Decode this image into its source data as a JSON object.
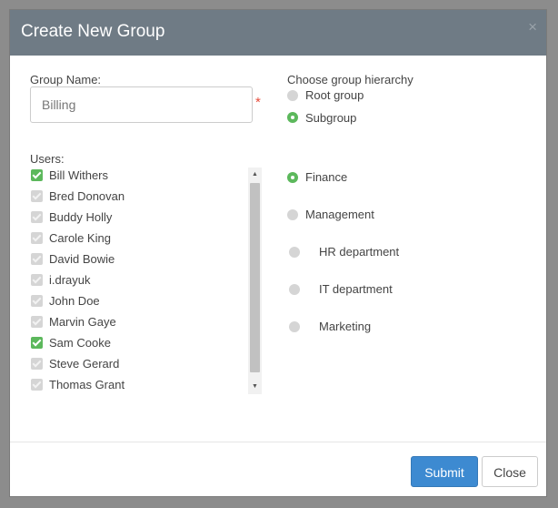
{
  "dialog": {
    "title": "Create New Group",
    "close_glyph": "×"
  },
  "form": {
    "group_name_label": "Group Name:",
    "group_name_value": "Billing",
    "required_mark": "*",
    "users_label": "Users:"
  },
  "users": [
    {
      "name": "Bill Withers",
      "checked": true
    },
    {
      "name": "Bred Donovan",
      "checked": false
    },
    {
      "name": "Buddy Holly",
      "checked": false
    },
    {
      "name": "Carole King",
      "checked": false
    },
    {
      "name": "David Bowie",
      "checked": false
    },
    {
      "name": "i.drayuk",
      "checked": false
    },
    {
      "name": "John Doe",
      "checked": false
    },
    {
      "name": "Marvin Gaye",
      "checked": false
    },
    {
      "name": "Sam Cooke",
      "checked": true
    },
    {
      "name": "Steve Gerard",
      "checked": false
    },
    {
      "name": "Thomas Grant",
      "checked": false
    }
  ],
  "hierarchy": {
    "label": "Choose group hierarchy",
    "root_label": "Root group",
    "subgroup_label": "Subgroup",
    "selected": "subgroup"
  },
  "parents": [
    {
      "name": "Finance",
      "selected": true
    },
    {
      "name": "Management",
      "selected": false
    },
    {
      "name": "HR department",
      "selected": false
    },
    {
      "name": "IT department",
      "selected": false
    },
    {
      "name": "Marketing",
      "selected": false
    }
  ],
  "footer": {
    "submit_label": "Submit",
    "close_label": "Close"
  },
  "colors": {
    "header_bg": "#6f7b85",
    "accent_green": "#5cb85c",
    "primary_blue": "#3d8ad1",
    "required_red": "#e74c3c"
  },
  "icons": {
    "close": "close-icon",
    "scroll_up": "scroll-up-arrow-icon",
    "scroll_down": "scroll-down-arrow-icon",
    "checkbox": "checkmark-icon"
  }
}
